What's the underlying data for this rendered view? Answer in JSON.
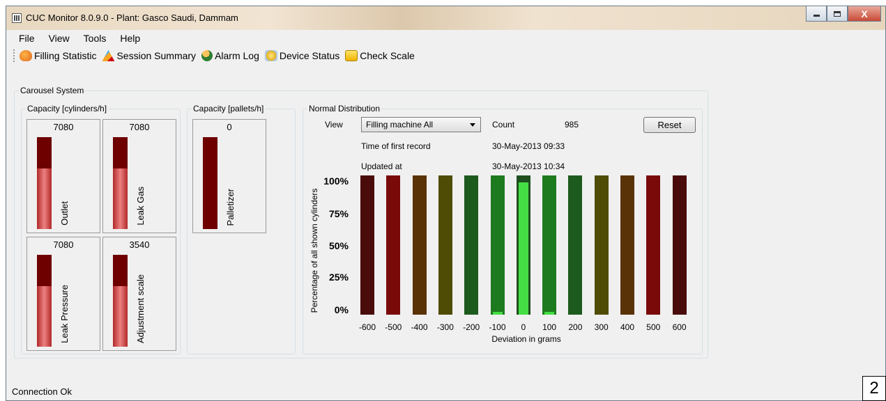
{
  "window": {
    "title": "CUC Monitor 8.0.9.0 - Plant: Gasco Saudi, Dammam",
    "close_glyph": "X"
  },
  "menu": [
    "File",
    "View",
    "Tools",
    "Help"
  ],
  "toolbar": [
    {
      "label": "Filling Statistic",
      "icon": "filling-statistic-icon"
    },
    {
      "label": "Session Summary",
      "icon": "session-summary-icon"
    },
    {
      "label": "Alarm Log",
      "icon": "alarm-log-icon"
    },
    {
      "label": "Device Status",
      "icon": "device-status-icon"
    },
    {
      "label": "Check Scale",
      "icon": "check-scale-icon"
    }
  ],
  "carousel": {
    "title": "Carousel System",
    "capacity_cylinders": {
      "title": "Capacity [cylinders/h]",
      "gauges": [
        {
          "value": "7080",
          "label": "Outlet",
          "level": 0.66
        },
        {
          "value": "7080",
          "label": "Leak Gas",
          "level": 0.66
        },
        {
          "value": "7080",
          "label": "Leak Pressure",
          "level": 0.66
        },
        {
          "value": "3540",
          "label": "Adjustment scale",
          "level": 0.66
        }
      ]
    },
    "capacity_pallets": {
      "title": "Capacity [pallets/h]",
      "gauges": [
        {
          "value": "0",
          "label": "Palletizer",
          "level": 0.0
        }
      ]
    },
    "normal_distribution": {
      "title": "Normal Distribution",
      "view_label": "View",
      "view_value": "Filling machine All",
      "count_label": "Count",
      "count_value": "985",
      "reset_label": "Reset",
      "first_record_label": "Time of first record",
      "first_record_value": "30-May-2013 09:33",
      "updated_label": "Updated at",
      "updated_value": "30-May-2013 10:34"
    }
  },
  "chart_data": {
    "type": "bar",
    "categories": [
      "-600",
      "-500",
      "-400",
      "-300",
      "-200",
      "-100",
      "0",
      "100",
      "200",
      "300",
      "400",
      "500",
      "600"
    ],
    "values": [
      0,
      0,
      0,
      0,
      0,
      2,
      95,
      2,
      0,
      0,
      0,
      0,
      0
    ],
    "bar_colors": [
      "#4a0b0b",
      "#7a0a0a",
      "#5a3208",
      "#4f4c05",
      "#1d5a1d",
      "#1e7a1e",
      "#1f4f1f",
      "#1e7a1e",
      "#1d5a1d",
      "#4f4c05",
      "#5a3208",
      "#7a0a0a",
      "#4a0b0b"
    ],
    "fill_color": "#44dd44",
    "yticks": [
      "100%",
      "75%",
      "50%",
      "25%",
      "0%"
    ],
    "ylim": [
      0,
      100
    ],
    "ylabel": "Percentage of all shown cylinders",
    "xlabel": "Deviation in grams"
  },
  "status": {
    "text": "Connection Ok",
    "corner_number": "2"
  }
}
